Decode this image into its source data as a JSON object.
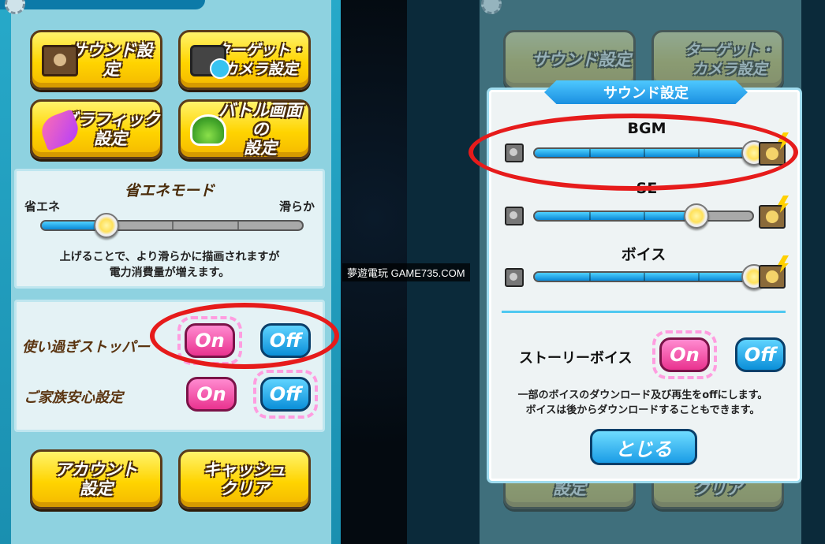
{
  "options_menu": {
    "sound_settings": "サウンド設定",
    "target_camera_settings": "ターゲット・\nカメラ設定",
    "graphic_settings": "グラフィック\n設定",
    "battle_screen_settings": "バトル画面の\n設定",
    "account_settings": "アカウント\n設定",
    "cache_clear": "キャッシュ\nクリア"
  },
  "power_save": {
    "title": "省エネモード",
    "left_label": "省エネ",
    "right_label": "滑らか",
    "level": 0.25,
    "description": "上げることで、より滑らかに描画されますが\n電力消費量が増えます。"
  },
  "stoppers": {
    "overuse_stopper_label": "使い過ぎストッパー",
    "family_safety_label": "ご家族安心設定",
    "on_label": "On",
    "off_label": "Off",
    "overuse_selected": "On",
    "family_selected": "Off"
  },
  "sound_modal": {
    "title": "サウンド設定",
    "bgm_label": "BGM",
    "bgm_level": 1.0,
    "se_label": "SE",
    "se_level": 0.74,
    "voice_label": "ボイス",
    "voice_level": 1.0,
    "story_voice_label": "ストーリーボイス",
    "story_voice_selected": "On",
    "on_label": "On",
    "off_label": "Off",
    "note": "一部のボイスのダウンロード及び再生をoffにします。\nボイスは後からダウンロードすることもできます。",
    "close_label": "とじる"
  },
  "watermark": "夢遊電玩 GAME735.COM",
  "colors": {
    "annotation": "#e61b1b",
    "on_pink": "#e9338f",
    "off_blue": "#0b8fd8",
    "button_yellow": "#ffd400"
  },
  "icons": [
    "gear-icon",
    "speaker-icon",
    "camera-icon",
    "brush-icon",
    "dome-icon",
    "volume-low-icon",
    "volume-high-icon"
  ]
}
